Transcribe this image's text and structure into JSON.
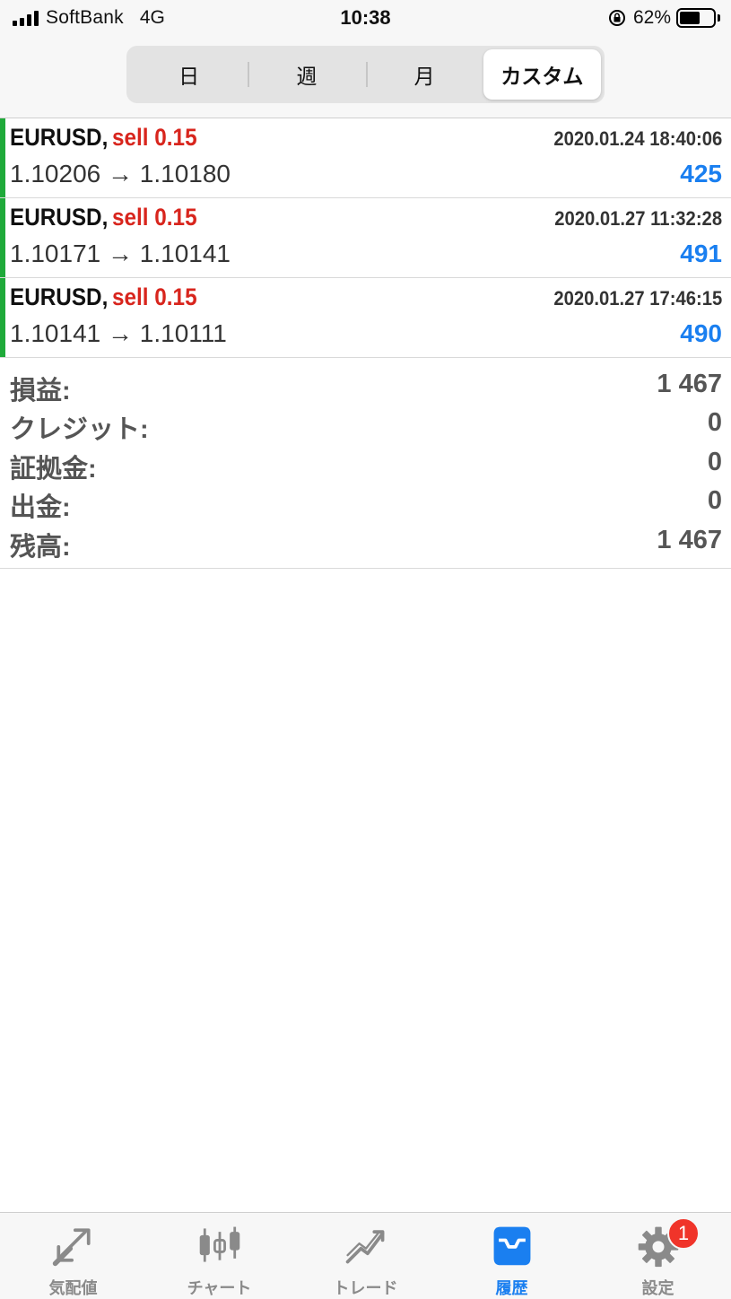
{
  "status_bar": {
    "carrier": "SoftBank",
    "network": "4G",
    "time": "10:38",
    "battery_percent": "62%",
    "battery_level": 0.62,
    "icons": [
      "signal-icon",
      "orientation-lock-icon",
      "battery-icon"
    ]
  },
  "period_tabs": [
    {
      "label": "日",
      "active": false
    },
    {
      "label": "週",
      "active": false
    },
    {
      "label": "月",
      "active": false
    },
    {
      "label": "カスタム",
      "active": true
    }
  ],
  "deals": [
    {
      "symbol": "EURUSD,",
      "side": "sell 0.15",
      "time": "2020.01.24 18:40:06",
      "prices": "1.10206 → 1.10180",
      "profit": "425"
    },
    {
      "symbol": "EURUSD,",
      "side": "sell 0.15",
      "time": "2020.01.27 11:32:28",
      "prices": "1.10171 → 1.10141",
      "profit": "491"
    },
    {
      "symbol": "EURUSD,",
      "side": "sell 0.15",
      "time": "2020.01.27 17:46:15",
      "prices": "1.10141 → 1.10111",
      "profit": "490"
    }
  ],
  "summary": [
    {
      "label": "損益:",
      "value": "1 467"
    },
    {
      "label": "クレジット:",
      "value": "0"
    },
    {
      "label": "証拠金:",
      "value": "0"
    },
    {
      "label": "出金:",
      "value": "0"
    },
    {
      "label": "残高:",
      "value": "1 467"
    }
  ],
  "tabbar": [
    {
      "label": "気配値",
      "icon": "quotes-icon",
      "active": false
    },
    {
      "label": "チャート",
      "icon": "candlestick-icon",
      "active": false
    },
    {
      "label": "トレード",
      "icon": "trade-icon",
      "active": false
    },
    {
      "label": "履歴",
      "icon": "inbox-icon",
      "active": true
    },
    {
      "label": "設定",
      "icon": "gear-icon",
      "active": false,
      "badge": "1"
    }
  ],
  "colors": {
    "accent": "#1a7ff0",
    "sell": "#d8251d",
    "deal_bar": "#1faa3a",
    "badge": "#f0342a"
  }
}
